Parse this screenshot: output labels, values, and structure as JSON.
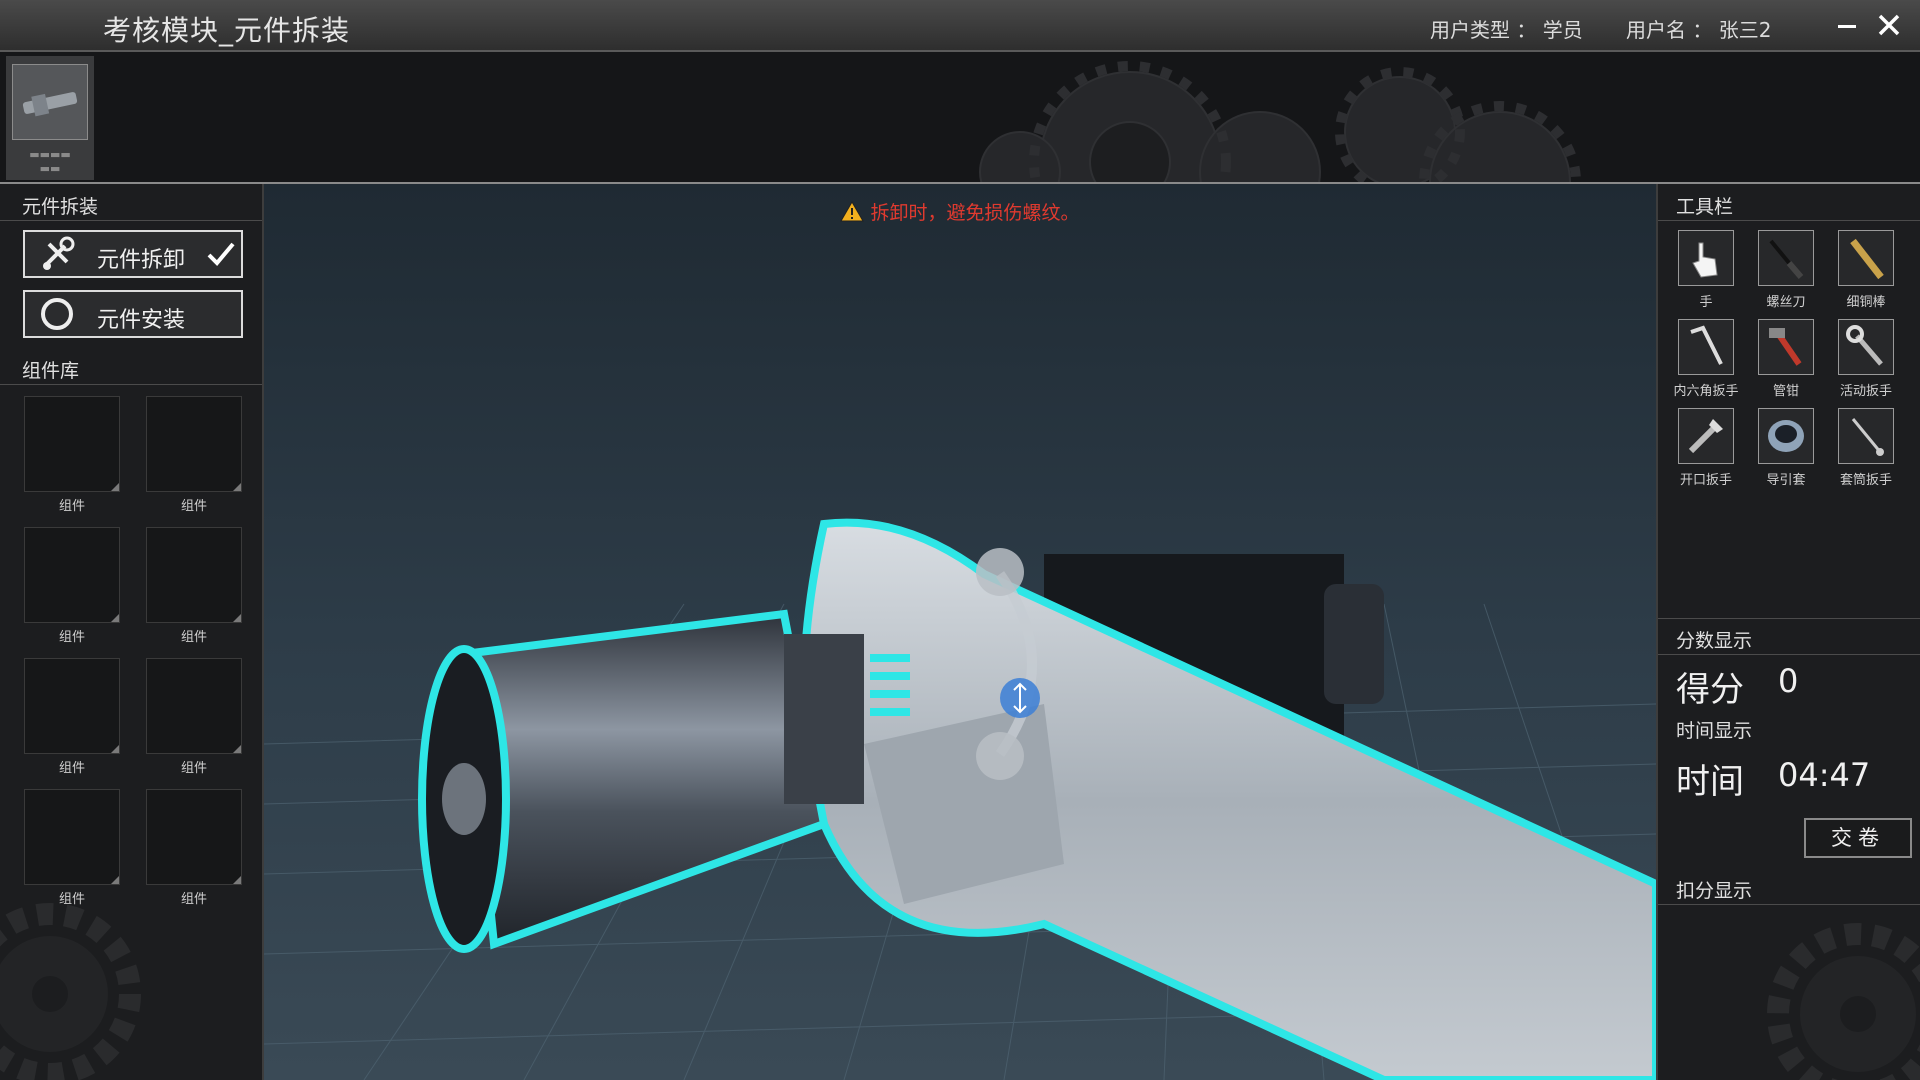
{
  "window": {
    "title": "考核模块_元件拆装",
    "user_type": "用户类型 ： 学员",
    "user_name": "用户名 ： 张三2",
    "minimize_icon": "minimize-icon",
    "close_icon": "close-icon"
  },
  "left_panel": {
    "section_title": "元件拆装",
    "modes": [
      {
        "label": "元件拆卸",
        "icon": "wrench-screwdriver-icon",
        "checked": true
      },
      {
        "label": "元件安装",
        "icon": "ring-icon",
        "checked": false
      }
    ],
    "library_title": "组件库",
    "components": [
      {
        "label": "组件"
      },
      {
        "label": "组件"
      },
      {
        "label": "组件"
      },
      {
        "label": "组件"
      },
      {
        "label": "组件"
      },
      {
        "label": "组件"
      },
      {
        "label": "组件"
      },
      {
        "label": "组件"
      }
    ]
  },
  "viewport": {
    "warning_text": "拆卸时，避免损伤螺纹。",
    "warning_icon": "warning-triangle-icon"
  },
  "right_panel": {
    "toolbar_title": "工具栏",
    "tools": [
      {
        "label": "手",
        "icon": "hand-pointer-icon"
      },
      {
        "label": "螺丝刀",
        "icon": "screwdriver-icon"
      },
      {
        "label": "细铜棒",
        "icon": "copper-rod-icon"
      },
      {
        "label": "内六角扳手",
        "icon": "hex-key-icon"
      },
      {
        "label": "管钳",
        "icon": "pipe-wrench-icon"
      },
      {
        "label": "活动扳手",
        "icon": "adjustable-wrench-icon"
      },
      {
        "label": "开口扳手",
        "icon": "open-end-wrench-icon"
      },
      {
        "label": "导引套",
        "icon": "guide-sleeve-icon"
      },
      {
        "label": "套筒扳手",
        "icon": "socket-wrench-icon"
      }
    ],
    "score_title": "分数显示",
    "score_label": "得分",
    "score_value": "0",
    "time_title": "时间显示",
    "time_label": "时间",
    "time_value": "04:47",
    "submit_label": "交卷",
    "deduction_title": "扣分显示"
  },
  "colors": {
    "warning": "#e03a2f",
    "highlight_outline": "#2ee6e6",
    "panel_bg": "#1c1d1f"
  }
}
